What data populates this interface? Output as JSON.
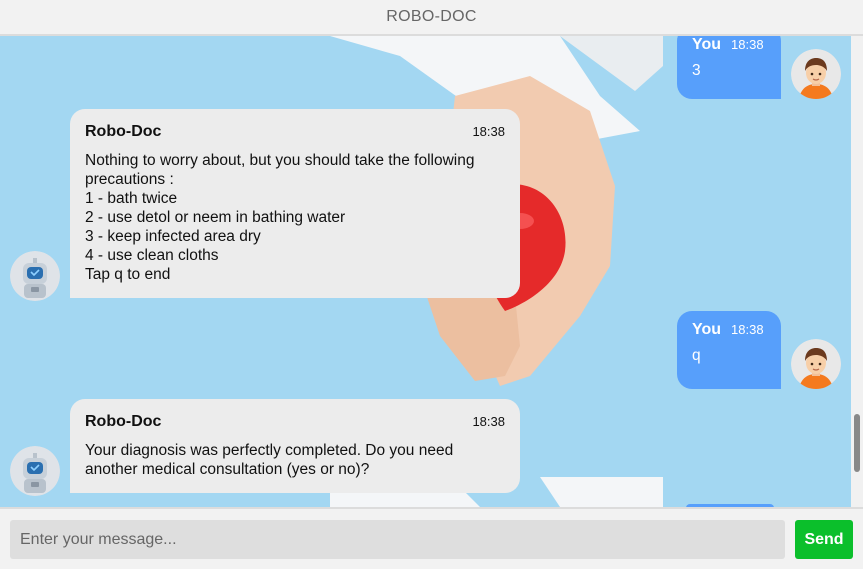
{
  "header": {
    "title": "ROBO-DOC"
  },
  "messages": [
    {
      "sender": "You",
      "time": "18:38",
      "text": "3"
    },
    {
      "sender": "Robo-Doc",
      "time": "18:38",
      "text": "Nothing to worry about, but you should take the following precautions :\n1 - bath twice\n2 - use detol or neem in bathing water\n3 - keep infected area dry\n4 - use clean cloths\nTap q to end"
    },
    {
      "sender": "You",
      "time": "18:38",
      "text": "q"
    },
    {
      "sender": "Robo-Doc",
      "time": "18:38",
      "text": "Your diagnosis was perfectly completed. Do you need another medical consultation (yes or no)?"
    }
  ],
  "composer": {
    "placeholder": "Enter your message...",
    "send_label": "Send"
  },
  "colors": {
    "bot_bubble": "#ececec",
    "user_bubble": "#579ffb",
    "send_button": "#0bbf2b",
    "background": "#a3d7f2"
  },
  "icons": {
    "user_avatar": "user-avatar-icon",
    "bot_avatar": "robot-avatar-icon"
  }
}
